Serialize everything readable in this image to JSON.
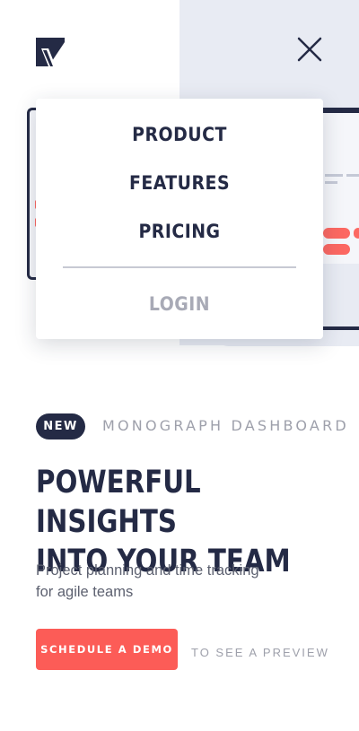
{
  "header": {
    "logo_icon": "monograph-logo-icon",
    "close_icon": "close-icon"
  },
  "menu": {
    "items": [
      {
        "label": "PRODUCT"
      },
      {
        "label": "FEATURES"
      },
      {
        "label": "PRICING"
      }
    ],
    "login_label": "LOGIN"
  },
  "hero": {
    "badge": "NEW",
    "eyebrow": "MONOGRAPH DASHBOARD",
    "headline_line1": "POWERFUL INSIGHTS",
    "headline_line2": "INTO YOUR TEAM",
    "subtext_line1": "Project planning and time tracking",
    "subtext_line2": "for agile teams",
    "cta_label": "SCHEDULE A DEMO",
    "cta_note": "TO SEE A PREVIEW"
  },
  "colors": {
    "dark": "#242a45",
    "accent": "#fc5c57",
    "muted": "#9ea0ab",
    "panel": "#e8ebf3"
  }
}
